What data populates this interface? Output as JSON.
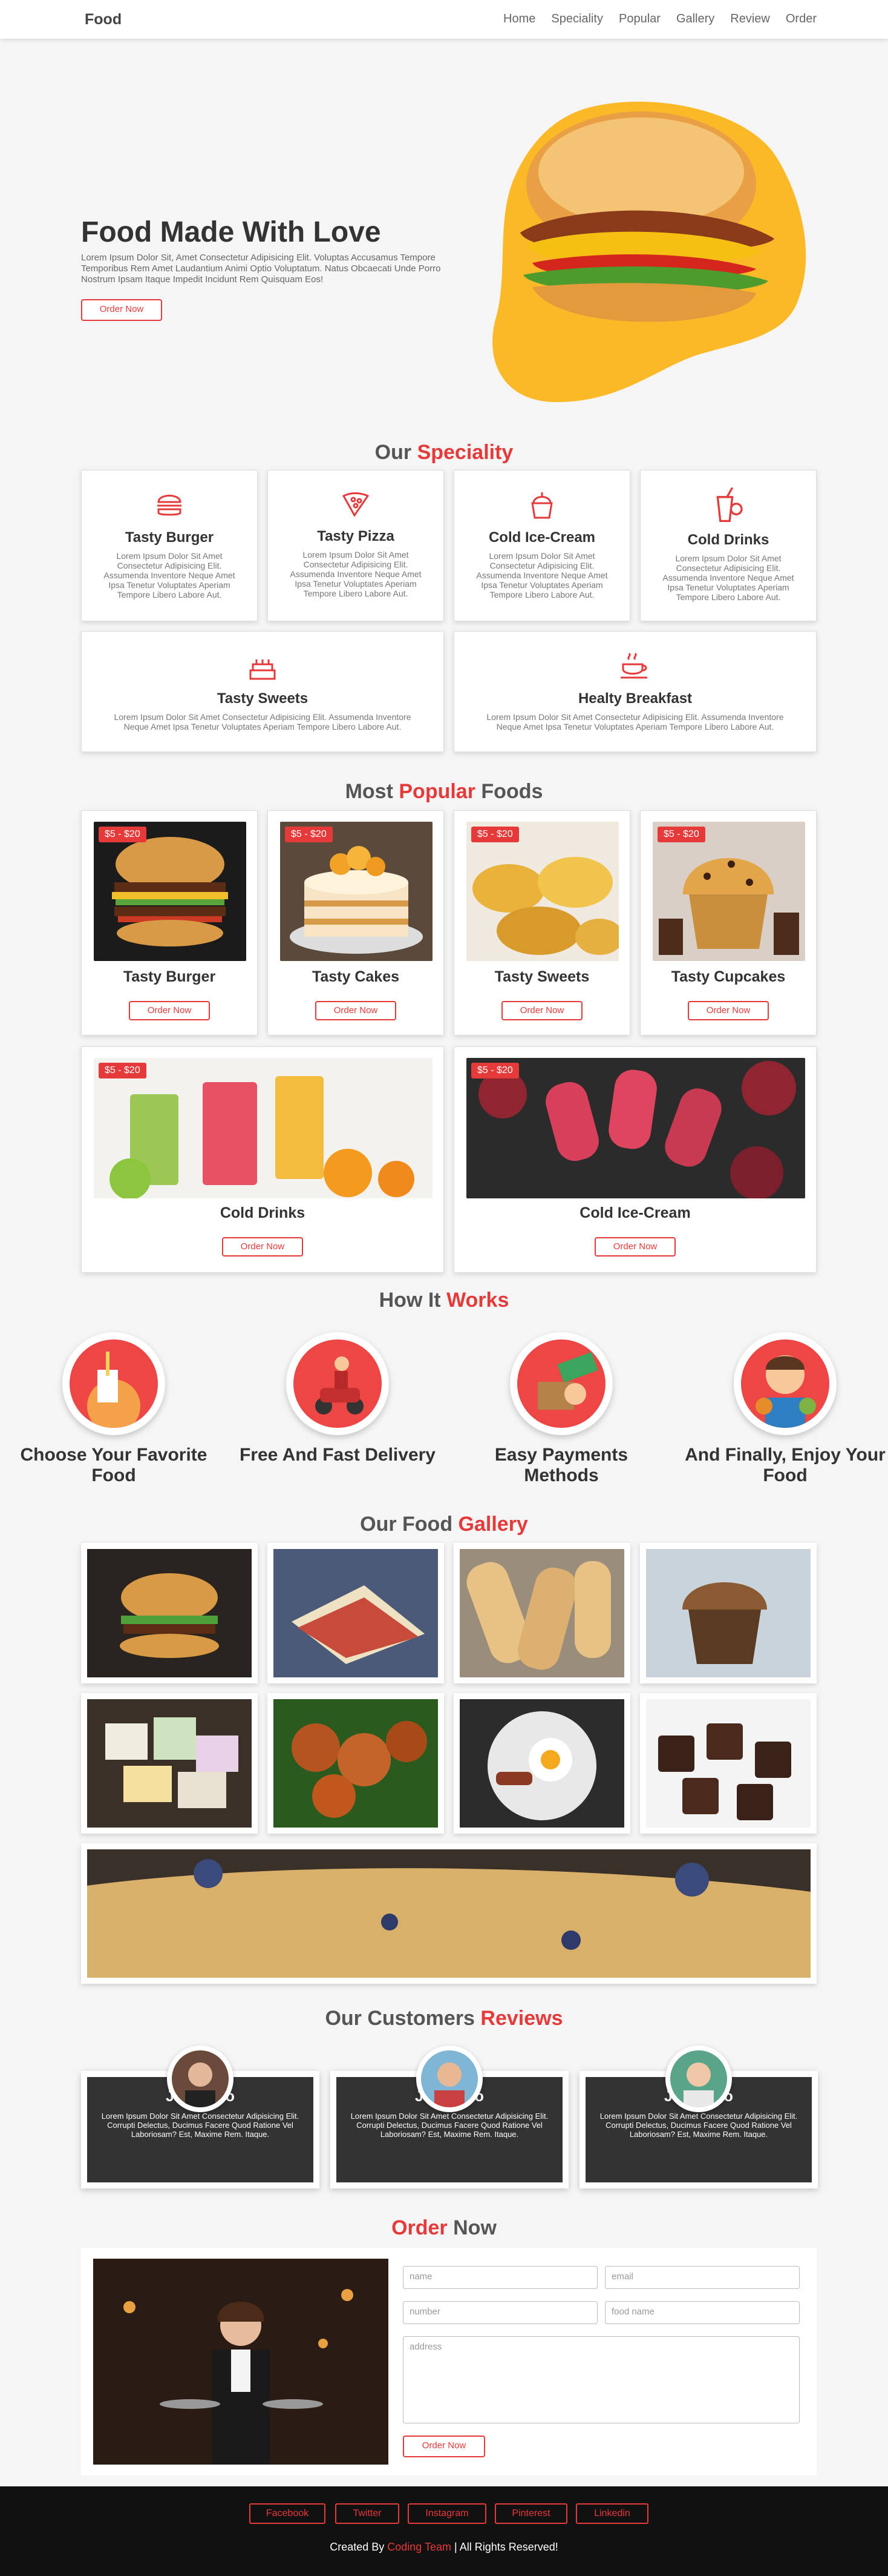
{
  "header": {
    "logo": "Food",
    "nav": [
      "Home",
      "Speciality",
      "Popular",
      "Gallery",
      "Review",
      "Order"
    ]
  },
  "home": {
    "title": "Food Made With Love",
    "text": "Lorem Ipsum Dolor Sit, Amet Consectetur Adipisicing Elit. Voluptas Accusamus Tempore Temporibus Rem Amet Laudantium Animi Optio Voluptatum. Natus Obcaecati Unde Porro Nostrum Ipsam Itaque Impedit Incidunt Rem Quisquam Eos!",
    "button": "Order Now"
  },
  "speciality": {
    "title_a": "Our",
    "title_b": "Speciality",
    "items": [
      {
        "name": "Tasty Burger",
        "icon": "burger-icon",
        "text": "Lorem Ipsum Dolor Sit Amet Consectetur Adipisicing Elit. Assumenda Inventore Neque Amet Ipsa Tenetur Voluptates Aperiam Tempore Libero Labore Aut."
      },
      {
        "name": "Tasty Pizza",
        "icon": "pizza-icon",
        "text": "Lorem Ipsum Dolor Sit Amet Consectetur Adipisicing Elit. Assumenda Inventore Neque Amet Ipsa Tenetur Voluptates Aperiam Tempore Libero Labore Aut."
      },
      {
        "name": "Cold Ice-Cream",
        "icon": "ice-cream-icon",
        "text": "Lorem Ipsum Dolor Sit Amet Consectetur Adipisicing Elit. Assumenda Inventore Neque Amet Ipsa Tenetur Voluptates Aperiam Tempore Libero Labore Aut."
      },
      {
        "name": "Cold Drinks",
        "icon": "drink-icon",
        "text": "Lorem Ipsum Dolor Sit Amet Consectetur Adipisicing Elit. Assumenda Inventore Neque Amet Ipsa Tenetur Voluptates Aperiam Tempore Libero Labore Aut."
      },
      {
        "name": "Tasty Sweets",
        "icon": "cake-icon",
        "text": "Lorem Ipsum Dolor Sit Amet Consectetur Adipisicing Elit. Assumenda Inventore Neque Amet Ipsa Tenetur Voluptates Aperiam Tempore Libero Labore Aut."
      },
      {
        "name": "Healty Breakfast",
        "icon": "coffee-icon",
        "text": "Lorem Ipsum Dolor Sit Amet Consectetur Adipisicing Elit. Assumenda Inventore Neque Amet Ipsa Tenetur Voluptates Aperiam Tempore Libero Labore Aut."
      }
    ]
  },
  "popular": {
    "title_a": "Most",
    "title_b": "Popular",
    "title_c": "Foods",
    "button": "Order Now",
    "items": [
      {
        "name": "Tasty Burger",
        "price": "$5 - $20"
      },
      {
        "name": "Tasty Cakes",
        "price": "$5 - $20"
      },
      {
        "name": "Tasty Sweets",
        "price": "$5 - $20"
      },
      {
        "name": "Tasty Cupcakes",
        "price": "$5 - $20"
      },
      {
        "name": "Cold Drinks",
        "price": "$5 - $20"
      },
      {
        "name": "Cold Ice-Cream",
        "price": "$5 - $20"
      }
    ]
  },
  "steps": {
    "title_a": "How It",
    "title_b": "Works",
    "items": [
      {
        "name": "Choose Your Favorite Food"
      },
      {
        "name": "Free And Fast Delivery"
      },
      {
        "name": "Easy Payments Methods"
      },
      {
        "name": "And Finally, Enjoy Your Food"
      }
    ]
  },
  "gallery": {
    "title_a": "Our Food",
    "title_b": "Gallery"
  },
  "reviews": {
    "title_a": "Our Customers",
    "title_b": "Reviews",
    "items": [
      {
        "name": "John Deo",
        "text": "Lorem Ipsum Dolor Sit Amet Consectetur Adipisicing Elit. Corrupti Delectus, Ducimus Facere Quod Ratione Vel Laboriosam? Est, Maxime Rem. Itaque."
      },
      {
        "name": "John Deo",
        "text": "Lorem Ipsum Dolor Sit Amet Consectetur Adipisicing Elit. Corrupti Delectus, Ducimus Facere Quod Ratione Vel Laboriosam? Est, Maxime Rem. Itaque."
      },
      {
        "name": "John Deo",
        "text": "Lorem Ipsum Dolor Sit Amet Consectetur Adipisicing Elit. Corrupti Delectus, Ducimus Facere Quod Ratione Vel Laboriosam? Est, Maxime Rem. Itaque."
      }
    ]
  },
  "order": {
    "title_a": "Order",
    "title_b": "Now",
    "placeholders": {
      "name": "name",
      "email": "email",
      "number": "number",
      "food": "food name",
      "address": "address"
    },
    "button": "Order Now"
  },
  "footer": {
    "links": [
      "Facebook",
      "Twitter",
      "Instagram",
      "Pinterest",
      "Linkedin"
    ],
    "credit_a": "Created By",
    "credit_b": "Coding Team",
    "credit_c": "| All Rights Reserved!"
  },
  "colors": {
    "accent": "#e63a3a",
    "dark": "#333333",
    "footer": "#111111"
  }
}
